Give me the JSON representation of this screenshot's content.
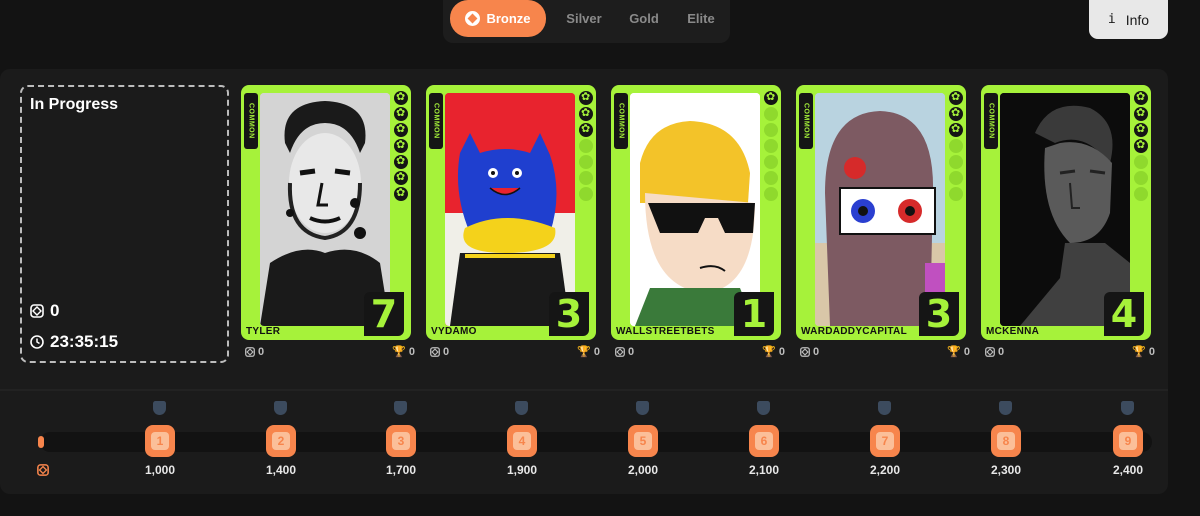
{
  "tiers": [
    {
      "label": "Bronze",
      "active": true
    },
    {
      "label": "Silver",
      "active": false
    },
    {
      "label": "Gold",
      "active": false
    },
    {
      "label": "Elite",
      "active": false
    }
  ],
  "info_button": {
    "icon": "i",
    "label": "Info"
  },
  "in_progress": {
    "title": "In Progress",
    "points": "0",
    "timer": "23:35:15"
  },
  "cards": [
    {
      "name": "TYLER",
      "rarity": "COMMON",
      "level": "7",
      "points": "0",
      "trophies": "0",
      "stars": 7,
      "image": "portrait-bw",
      "accent": "#a6f23a"
    },
    {
      "name": "VYDAMO",
      "rarity": "COMMON",
      "level": "3",
      "points": "0",
      "trophies": "0",
      "stars": 3,
      "image": "blue-cat",
      "accent": "#a6f23a"
    },
    {
      "name": "WALLSTREETBETS",
      "rarity": "COMMON",
      "level": "1",
      "points": "0",
      "trophies": "0",
      "stars": 1,
      "image": "sunglasses-guy",
      "accent": "#a6f23a"
    },
    {
      "name": "WARDADDYCAPITAL",
      "rarity": "COMMON",
      "level": "3",
      "points": "0",
      "trophies": "0",
      "stars": 3,
      "image": "hooded-figure",
      "accent": "#a6f23a"
    },
    {
      "name": "MCKENNA",
      "rarity": "COMMON",
      "level": "4",
      "points": "0",
      "trophies": "0",
      "stars": 4,
      "image": "statue",
      "accent": "#a6f23a"
    }
  ],
  "progress": {
    "current": 0,
    "milestones": [
      {
        "level": "1",
        "value": "1,000"
      },
      {
        "level": "2",
        "value": "1,400"
      },
      {
        "level": "3",
        "value": "1,700"
      },
      {
        "level": "4",
        "value": "1,900"
      },
      {
        "level": "5",
        "value": "2,000"
      },
      {
        "level": "6",
        "value": "2,100"
      },
      {
        "level": "7",
        "value": "2,200"
      },
      {
        "level": "8",
        "value": "2,300"
      },
      {
        "level": "9",
        "value": "2,400"
      }
    ]
  },
  "colors": {
    "accent": "#f7854c",
    "card": "#a6f23a",
    "background": "#131313",
    "panel": "#1b1b1b"
  }
}
